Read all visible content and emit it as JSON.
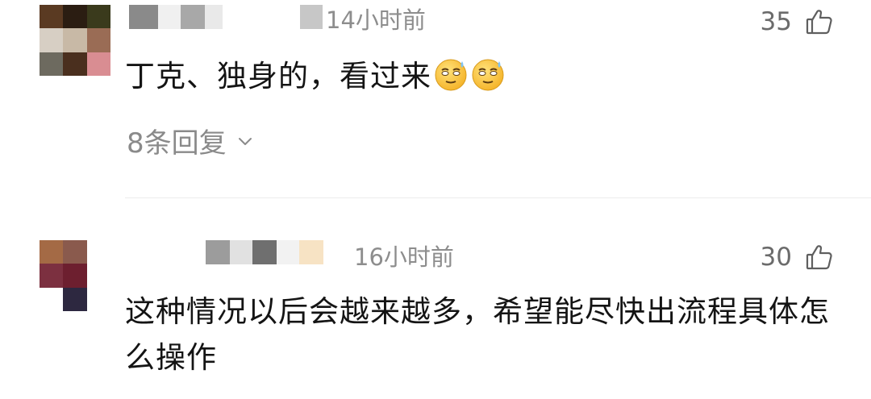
{
  "comments": [
    {
      "time": "14小时前",
      "likes": "35",
      "text": "丁克、独身的，看过来",
      "emoji_count": 2,
      "replies_label": "8条回复",
      "avatar_colors": [
        "#5a3a22",
        "#2b1d12",
        "#3a3a1c",
        "#d7cfc4",
        "#c8b9a6",
        "#9a6c55",
        "#6d6a5f",
        "#4a2f1e",
        "#d98d92"
      ],
      "name_colors": [
        "#8a8a8a",
        "#f0f0f0",
        "#a8a8a8",
        "#e9e9e9",
        "#ffffff",
        "#c7c7c7"
      ]
    },
    {
      "time": "16小时前",
      "likes": "30",
      "text": "这种情况以后会越来越多，希望能尽快出流程具体怎么操作",
      "avatar_colors": [
        "#a46a45",
        "#8a5a4d",
        "#ffffff",
        "#7c3040",
        "#6d1f2f",
        "#ffffff",
        "#ffffff",
        "#2d2840",
        "#ffffff"
      ],
      "name_colors": [
        "#9c9c9c",
        "#e1e1e1",
        "#6f6f6f",
        "#f2f2f2",
        "#f7e3c4"
      ]
    }
  ],
  "icons": {
    "like": "thumbs-up-outline-icon",
    "chevron": "chevron-down-icon",
    "emoji": "sweat-smile-emoji"
  }
}
